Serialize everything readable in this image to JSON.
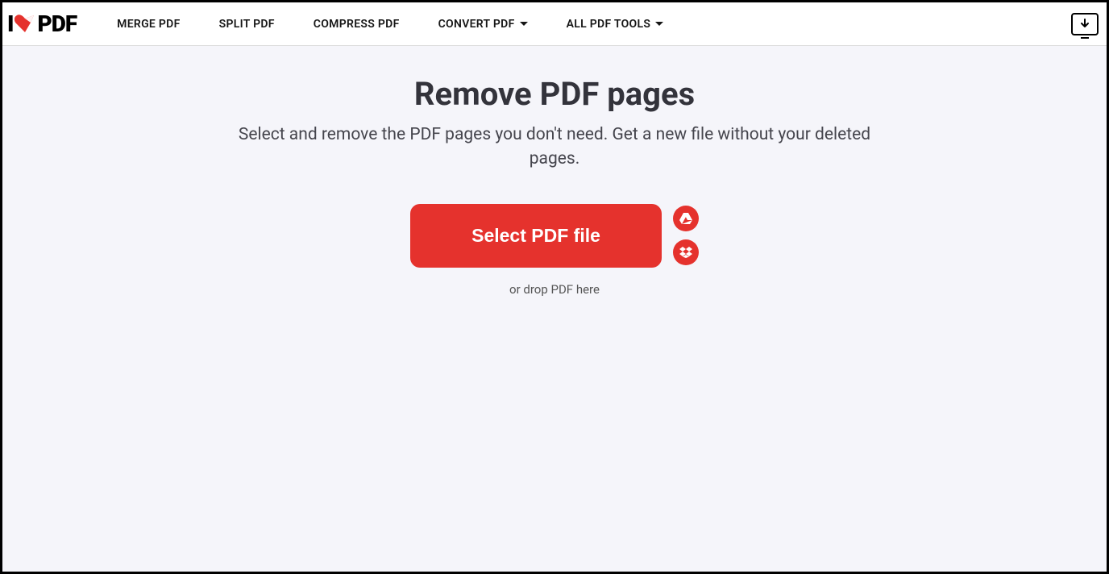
{
  "logo": {
    "text_left": "I",
    "text_right": "PDF"
  },
  "nav": {
    "merge": "MERGE PDF",
    "split": "SPLIT PDF",
    "compress": "COMPRESS PDF",
    "convert": "CONVERT PDF",
    "all_tools": "ALL PDF TOOLS"
  },
  "main": {
    "title": "Remove PDF pages",
    "subtitle": "Select and remove the PDF pages you don't need. Get a new file without your deleted pages.",
    "select_button": "Select PDF file",
    "drop_text": "or drop PDF here"
  },
  "colors": {
    "accent": "#e5322d"
  }
}
